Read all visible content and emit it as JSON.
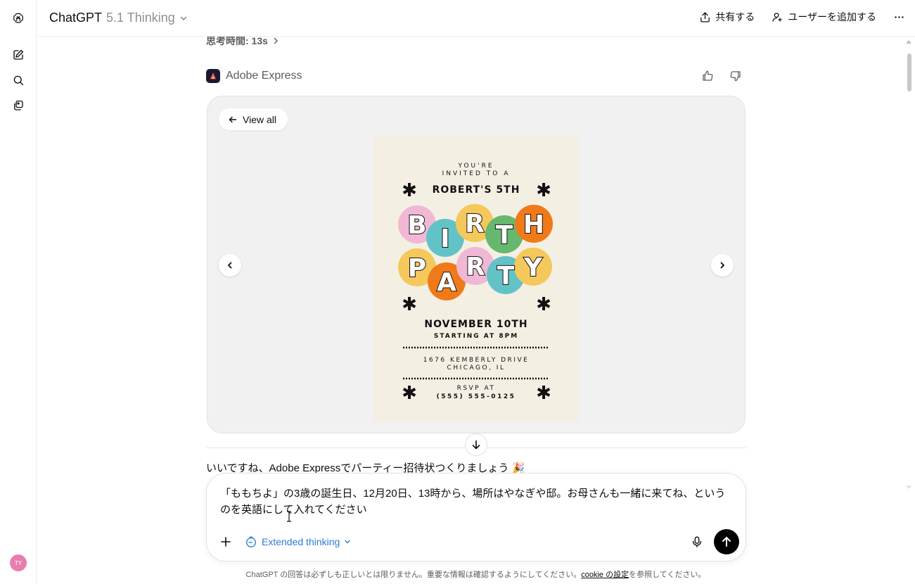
{
  "header": {
    "model_name": "ChatGPT",
    "model_version": "5.1 Thinking",
    "share_label": "共有する",
    "add_user_label": "ユーザーを追加する"
  },
  "sidebar": {
    "avatar_initials": "TY",
    "icons": [
      "openai-logo-icon",
      "new-chat-icon",
      "search-icon",
      "library-icon"
    ]
  },
  "conversation": {
    "thought_label": "思考時間: 13s",
    "app_name": "Adobe Express",
    "view_all_label": "View all",
    "reply_text": "いいですね、Adobe Expressでパーティー招待状つくりましょう 🎉"
  },
  "poster": {
    "line1": "YOU'RE",
    "line2": "INVITED TO A",
    "name": "ROBERT'S 5TH",
    "word1": [
      "B",
      "I",
      "R",
      "T",
      "H"
    ],
    "word2": [
      "P",
      "A",
      "R",
      "T",
      "Y"
    ],
    "date": "NOVEMBER 10TH",
    "time": "STARTING AT 8PM",
    "address1": "1676 KEMBERLY DRIVE",
    "address2": "CHICAGO, IL",
    "rsvp": "RSVP AT",
    "phone": "(555) 555-0125",
    "colors": {
      "pink": "#f0b8d4",
      "teal": "#62c3c7",
      "yellow": "#f4c85a",
      "green": "#66b86f",
      "orange": "#f07a1a",
      "background": "#f4efe3"
    }
  },
  "composer": {
    "text": "「ももちよ」の3歳の誕生日、12月20日、13時から、場所はやなぎや邸。お母さんも一緒に来てね、というのを英語にして入れてください",
    "mode_label": "Extended thinking"
  },
  "footer": {
    "disclaimer_pre": "ChatGPT の回答は必ずしも正しいとは限りません。重要な情報は確認するようにしてください。",
    "cookie_link": "cookie の設定",
    "disclaimer_post": "を参照してください。"
  }
}
